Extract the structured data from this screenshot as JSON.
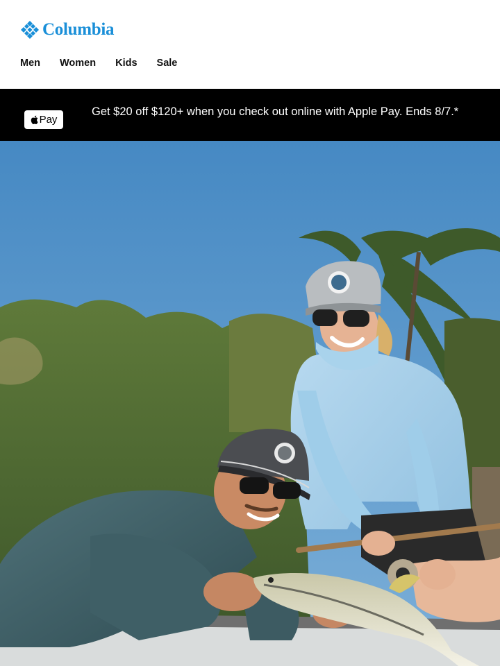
{
  "brand": {
    "name": "Columbia",
    "color": "#1a8fd8",
    "logo_icon": "columbia-diamond-grid-icon"
  },
  "nav": {
    "items": [
      {
        "label": "Men"
      },
      {
        "label": "Women"
      },
      {
        "label": "Kids"
      },
      {
        "label": "Sale"
      }
    ]
  },
  "promo": {
    "badge_label": "Pay",
    "badge_icon": "apple-icon",
    "text": "Get $20 off $120+ when you check out online with Apple Pay. Ends 8/7.*",
    "background": "#000000"
  },
  "hero": {
    "icon": "hero-photo",
    "sky_color": "#4d8fc6"
  }
}
